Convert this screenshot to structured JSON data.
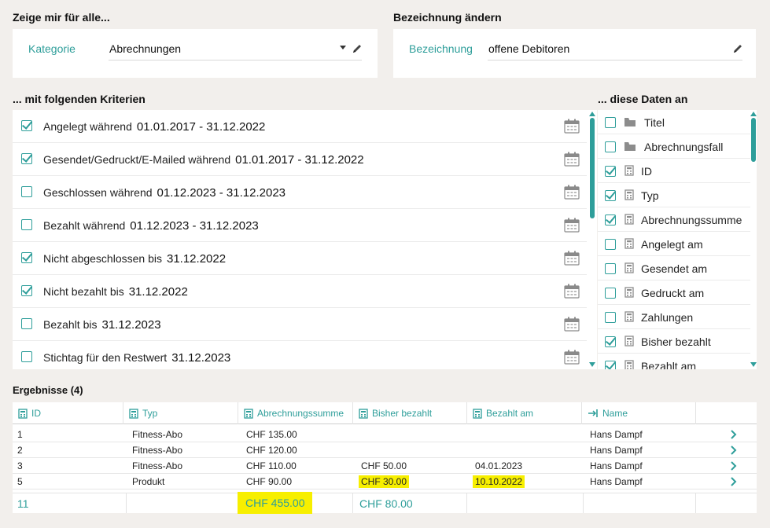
{
  "show_for": {
    "title": "Zeige mir für alle...",
    "label": "Kategorie",
    "value": "Abrechnungen"
  },
  "rename": {
    "title": "Bezeichnung ändern",
    "label": "Bezeichnung",
    "value": "offene Debitoren"
  },
  "criteria": {
    "title": "... mit folgenden Kriterien",
    "items": [
      {
        "label": "Angelegt während",
        "date": "01.01.2017 - 31.12.2022",
        "checked": true
      },
      {
        "label": "Gesendet/Gedruckt/E-Mailed während",
        "date": "01.01.2017 - 31.12.2022",
        "checked": true
      },
      {
        "label": "Geschlossen während",
        "date": "01.12.2023 - 31.12.2023",
        "checked": false
      },
      {
        "label": "Bezahlt während",
        "date": "01.12.2023 - 31.12.2023",
        "checked": false
      },
      {
        "label": "Nicht abgeschlossen bis",
        "date": "31.12.2022",
        "checked": true
      },
      {
        "label": "Nicht bezahlt bis",
        "date": "31.12.2022",
        "checked": true
      },
      {
        "label": "Bezahlt bis",
        "date": "31.12.2023",
        "checked": false
      },
      {
        "label": "Stichtag für den Restwert",
        "date": "31.12.2023",
        "checked": false
      }
    ]
  },
  "data_fields": {
    "title": "... diese Daten an",
    "items": [
      {
        "label": "Titel",
        "checked": false,
        "icon": "folder-icon"
      },
      {
        "label": "Abrechnungsfall",
        "checked": false,
        "icon": "folder-icon"
      },
      {
        "label": "ID",
        "checked": true,
        "icon": "calculator-icon"
      },
      {
        "label": "Typ",
        "checked": true,
        "icon": "calculator-icon"
      },
      {
        "label": "Abrechnungssumme",
        "checked": true,
        "icon": "calculator-icon"
      },
      {
        "label": "Angelegt am",
        "checked": false,
        "icon": "calculator-icon"
      },
      {
        "label": "Gesendet am",
        "checked": false,
        "icon": "calculator-icon"
      },
      {
        "label": "Gedruckt am",
        "checked": false,
        "icon": "calculator-icon"
      },
      {
        "label": "Zahlungen",
        "checked": false,
        "icon": "calculator-icon"
      },
      {
        "label": "Bisher bezahlt",
        "checked": true,
        "icon": "calculator-icon"
      },
      {
        "label": "Bezahlt am",
        "checked": true,
        "icon": "calculator-icon"
      }
    ]
  },
  "results": {
    "title": "Ergebnisse (4)",
    "columns": [
      "ID",
      "Typ",
      "Abrechnungssumme",
      "Bisher bezahlt",
      "Bezahlt am",
      "Name"
    ],
    "rows": [
      {
        "id": "1",
        "typ": "Fitness-Abo",
        "summe": "CHF 135.00",
        "bezahlt": "",
        "bezahlt_am": "",
        "name": "Hans Dampf"
      },
      {
        "id": "2",
        "typ": "Fitness-Abo",
        "summe": "CHF 120.00",
        "bezahlt": "",
        "bezahlt_am": "",
        "name": "Hans Dampf"
      },
      {
        "id": "3",
        "typ": "Fitness-Abo",
        "summe": "CHF 110.00",
        "bezahlt": "CHF 50.00",
        "bezahlt_am": "04.01.2023",
        "name": "Hans Dampf"
      },
      {
        "id": "5",
        "typ": "Produkt",
        "summe": "CHF 90.00",
        "bezahlt": "CHF 30.00",
        "bezahlt_am": "10.10.2022",
        "name": "Hans Dampf"
      }
    ],
    "totals": {
      "id": "11",
      "summe": "CHF 455.00",
      "bezahlt": "CHF 80.00"
    }
  },
  "colors": {
    "accent": "#2e9e9a",
    "highlight": "#f7ef00",
    "background": "#f2efec"
  }
}
